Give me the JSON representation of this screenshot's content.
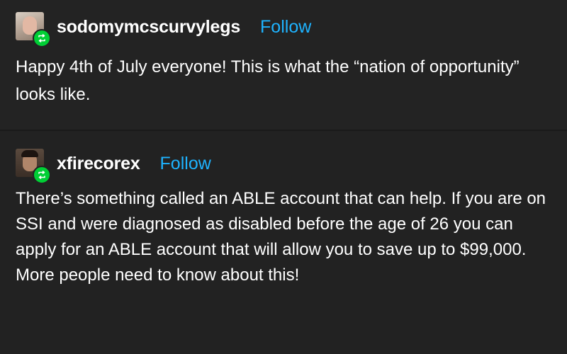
{
  "posts": [
    {
      "username": "sodomymcscurvylegs",
      "follow_label": "Follow",
      "avatar_icon": "user-avatar-icon",
      "badge_icon": "reblog-icon",
      "text": "Happy 4th of July everyone! This is what the “nation of opportunity” looks like."
    },
    {
      "username": "xfirecorex",
      "follow_label": "Follow",
      "avatar_icon": "user-avatar-icon",
      "badge_icon": "reblog-icon",
      "text": "There’s something called an ABLE account that can help. If you are on SSI and were diagnosed as disabled before the age of 26 you can apply for an ABLE account that will allow you to save up to $99,000. More people need to know about this!"
    }
  ],
  "colors": {
    "background": "#222222",
    "text": "#ffffff",
    "follow": "#1eb3ff",
    "badge": "#00cf35"
  }
}
